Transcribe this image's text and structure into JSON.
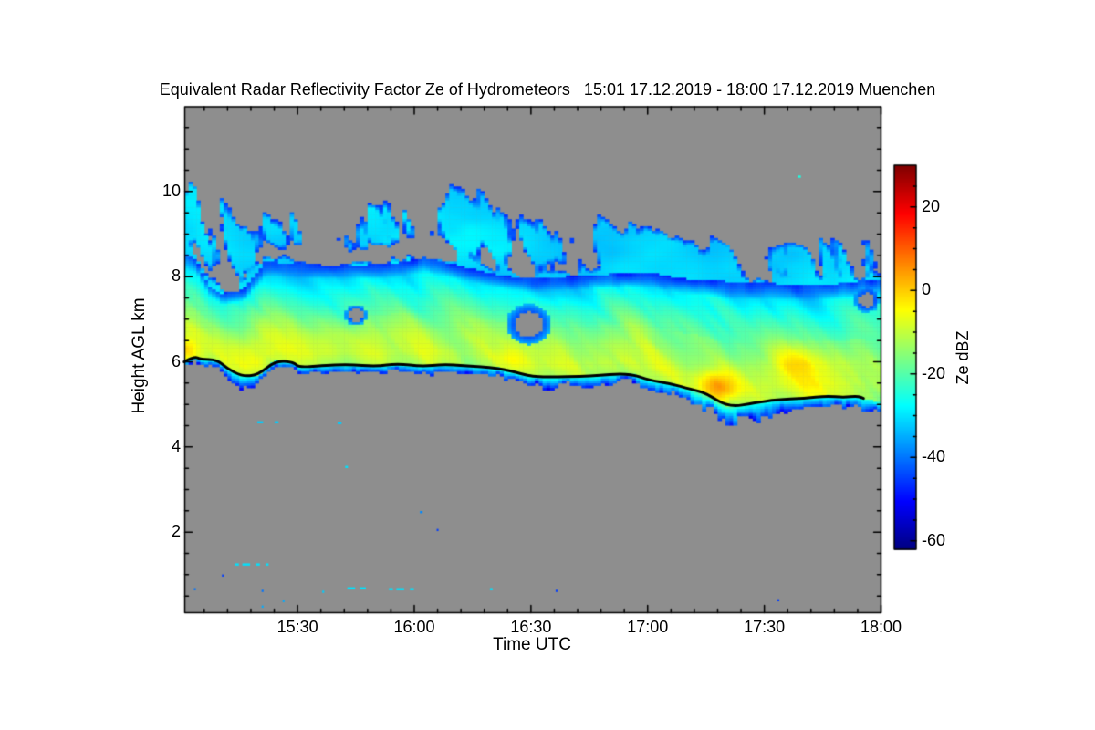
{
  "chart_data": {
    "type": "heatmap",
    "title": "Equivalent Radar Reflectivity Factor Ze of Hydrometeors   15:01 17.12.2019 - 18:00 17.12.2019 Muenchen",
    "xlabel": "Time UTC",
    "ylabel": "Height AGL km",
    "xlim_hours": [
      15.0167,
      18.0
    ],
    "ylim_km": [
      0.107,
      11.99
    ],
    "x_ticks": [
      {
        "t": 15.5,
        "label": "15:30"
      },
      {
        "t": 16.0,
        "label": "16:00"
      },
      {
        "t": 16.5,
        "label": "16:30"
      },
      {
        "t": 17.0,
        "label": "17:00"
      },
      {
        "t": 17.5,
        "label": "17:30"
      },
      {
        "t": 18.0,
        "label": "18:00"
      }
    ],
    "x_minor_step_hours": 0.1,
    "y_ticks": [
      {
        "km": 2,
        "label": "2"
      },
      {
        "km": 4,
        "label": "4"
      },
      {
        "km": 6,
        "label": "6"
      },
      {
        "km": 8,
        "label": "8"
      },
      {
        "km": 10,
        "label": "10"
      }
    ],
    "y_minor_step_km": 0.5,
    "colorbar": {
      "label": "Ze dBZ",
      "colormap": "jet",
      "vmin": -62,
      "vmax": 30,
      "ticks": [
        {
          "dbz": 20,
          "label": "20"
        },
        {
          "dbz": 0,
          "label": "0"
        },
        {
          "dbz": -20,
          "label": "-20"
        },
        {
          "dbz": -40,
          "label": "-40"
        },
        {
          "dbz": -60,
          "label": "-60"
        }
      ],
      "minor_step_dbz": 5
    },
    "no_data_color": "#8e8e8e",
    "line_color": "#000000",
    "cloud_base_line_km": [
      [
        15.014,
        6.0
      ],
      [
        15.057,
        6.13
      ],
      [
        15.085,
        6.06
      ],
      [
        15.155,
        6.05
      ],
      [
        15.194,
        5.86
      ],
      [
        15.261,
        5.66
      ],
      [
        15.33,
        5.69
      ],
      [
        15.406,
        6.03
      ],
      [
        15.484,
        5.99
      ],
      [
        15.504,
        5.87
      ],
      [
        15.602,
        5.91
      ],
      [
        15.719,
        5.94
      ],
      [
        15.837,
        5.89
      ],
      [
        15.927,
        5.96
      ],
      [
        16.033,
        5.89
      ],
      [
        16.123,
        5.94
      ],
      [
        16.213,
        5.91
      ],
      [
        16.358,
        5.86
      ],
      [
        16.464,
        5.71
      ],
      [
        16.507,
        5.66
      ],
      [
        16.562,
        5.64
      ],
      [
        16.758,
        5.66
      ],
      [
        16.915,
        5.74
      ],
      [
        17.013,
        5.56
      ],
      [
        17.091,
        5.5
      ],
      [
        17.189,
        5.35
      ],
      [
        17.248,
        5.27
      ],
      [
        17.346,
        4.93
      ],
      [
        17.463,
        5.04
      ],
      [
        17.553,
        5.11
      ],
      [
        17.671,
        5.14
      ],
      [
        17.769,
        5.2
      ],
      [
        17.839,
        5.16
      ],
      [
        17.898,
        5.2
      ],
      [
        17.925,
        5.14
      ]
    ],
    "cloud_base_extension_km": [
      [
        18.0,
        5.02
      ]
    ],
    "cloud_deck_top_km": [
      [
        15.01,
        8.6
      ],
      [
        15.07,
        8.35
      ],
      [
        15.12,
        7.8
      ],
      [
        15.18,
        7.55
      ],
      [
        15.27,
        7.7
      ],
      [
        15.36,
        8.35
      ],
      [
        15.5,
        8.3
      ],
      [
        15.7,
        8.25
      ],
      [
        15.9,
        8.3
      ],
      [
        16.05,
        8.45
      ],
      [
        16.2,
        8.25
      ],
      [
        16.35,
        8.05
      ],
      [
        16.5,
        7.95
      ],
      [
        16.65,
        8.0
      ],
      [
        16.8,
        8.05
      ],
      [
        17.0,
        8.1
      ],
      [
        17.15,
        7.95
      ],
      [
        17.3,
        7.9
      ],
      [
        17.5,
        7.85
      ],
      [
        17.7,
        7.8
      ],
      [
        17.85,
        7.85
      ],
      [
        18.0,
        7.95
      ]
    ],
    "wisp_top_km": [
      [
        15.01,
        9.9
      ],
      [
        15.05,
        11.25
      ],
      [
        15.1,
        10.0
      ],
      [
        15.17,
        11.3
      ],
      [
        15.25,
        10.1
      ],
      [
        15.33,
        10.65
      ],
      [
        15.45,
        10.45
      ],
      [
        15.55,
        10.2
      ],
      [
        15.63,
        10.45
      ],
      [
        15.75,
        10.1
      ],
      [
        15.85,
        10.5
      ],
      [
        15.95,
        10.85
      ],
      [
        16.05,
        10.4
      ],
      [
        16.15,
        10.85
      ],
      [
        16.28,
        10.9
      ],
      [
        16.4,
        10.35
      ],
      [
        16.5,
        10.6
      ],
      [
        16.6,
        10.25
      ],
      [
        16.7,
        9.75
      ],
      [
        16.8,
        10.1
      ],
      [
        16.95,
        10.05
      ],
      [
        17.1,
        9.7
      ],
      [
        17.25,
        9.35
      ],
      [
        17.4,
        9.2
      ],
      [
        17.55,
        9.5
      ],
      [
        17.7,
        9.8
      ],
      [
        17.85,
        9.6
      ],
      [
        18.0,
        9.35
      ]
    ],
    "deck_profile_dbz": [
      [
        0,
        -13
      ],
      [
        0.12,
        -10
      ],
      [
        0.3,
        -12
      ],
      [
        0.5,
        -18
      ],
      [
        0.7,
        -24
      ],
      [
        0.85,
        -29
      ],
      [
        1.0,
        -37
      ]
    ],
    "bright_cells": [
      {
        "t": 17.3,
        "h": 5.4,
        "boost": 17,
        "sigma_t": 0.09,
        "sigma_h": 0.4
      },
      {
        "t": 15.035,
        "h": 6.25,
        "boost": 6,
        "sigma_t": 0.05,
        "sigma_h": 0.3
      },
      {
        "t": 16.42,
        "h": 6.05,
        "boost": 5,
        "sigma_t": 0.08,
        "sigma_h": 0.35
      },
      {
        "t": 17.62,
        "h": 6.0,
        "boost": 6,
        "sigma_t": 0.1,
        "sigma_h": 0.4
      }
    ],
    "deck_holes": [
      {
        "t": 16.49,
        "h": 6.88,
        "rt": 0.06,
        "rh": 0.3
      },
      {
        "t": 17.94,
        "h": 7.45,
        "rt": 0.035,
        "rh": 0.18
      },
      {
        "t": 15.75,
        "h": 7.1,
        "rt": 0.03,
        "rh": 0.15
      }
    ],
    "specks": [
      [
        15.34,
        4.58,
        -32,
        1.5
      ],
      [
        15.41,
        4.58,
        -32,
        1.0
      ],
      [
        15.68,
        4.56,
        -32,
        1.0
      ],
      [
        15.71,
        3.53,
        -30,
        0.7
      ],
      [
        16.03,
        2.47,
        -38,
        0.7
      ],
      [
        15.24,
        1.24,
        -30,
        1.0
      ],
      [
        15.28,
        1.24,
        -30,
        2.0
      ],
      [
        15.33,
        1.24,
        -30,
        1.0
      ],
      [
        15.37,
        1.24,
        -30,
        0.7
      ],
      [
        15.73,
        0.68,
        -30,
        2.0
      ],
      [
        15.78,
        0.68,
        -30,
        1.5
      ],
      [
        15.9,
        0.66,
        -30,
        1.0
      ],
      [
        15.94,
        0.66,
        -30,
        2.0
      ],
      [
        15.99,
        0.66,
        -30,
        1.0
      ],
      [
        16.33,
        0.66,
        -30,
        0.7
      ],
      [
        15.18,
        0.98,
        -45,
        0.5
      ],
      [
        15.06,
        0.66,
        -40,
        0.5
      ],
      [
        15.35,
        0.62,
        -40,
        0.5
      ],
      [
        15.61,
        0.6,
        -32,
        0.5
      ],
      [
        16.61,
        0.62,
        -45,
        0.5
      ],
      [
        17.56,
        0.4,
        -45,
        0.5
      ],
      [
        16.1,
        2.05,
        -45,
        0.4
      ],
      [
        15.35,
        0.25,
        -35,
        0.4
      ],
      [
        15.44,
        0.38,
        -35,
        0.4
      ],
      [
        17.65,
        10.35,
        -25,
        0.8
      ]
    ]
  }
}
